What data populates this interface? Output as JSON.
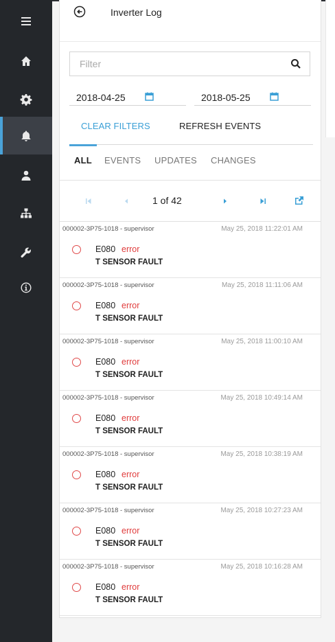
{
  "app": {
    "title": "Inverter Log"
  },
  "nav": {
    "items": [
      {
        "name": "menu",
        "icon": "hamburger-menu-icon"
      },
      {
        "name": "home",
        "icon": "home-icon"
      },
      {
        "name": "settings",
        "icon": "gear-icon"
      },
      {
        "name": "alerts",
        "icon": "bell-icon",
        "active": true
      },
      {
        "name": "user",
        "icon": "person-icon"
      },
      {
        "name": "hierarchy",
        "icon": "sitemap-icon"
      },
      {
        "name": "tools",
        "icon": "wrench-icon"
      },
      {
        "name": "info",
        "icon": "info-circle-icon"
      }
    ]
  },
  "filter": {
    "placeholder": "Filter",
    "value": ""
  },
  "dates": {
    "start": "2018-04-25",
    "end": "2018-05-25"
  },
  "actions": {
    "clear_filters": "CLEAR FILTERS",
    "refresh_events": "REFRESH EVENTS"
  },
  "tabs": [
    {
      "label": "ALL",
      "active": true
    },
    {
      "label": "EVENTS",
      "active": false
    },
    {
      "label": "UPDATES",
      "active": false
    },
    {
      "label": "CHANGES",
      "active": false
    }
  ],
  "pager": {
    "info": "1 of 42"
  },
  "events": [
    {
      "source": "000002-3P75-1018 - supervisor",
      "time": "May 25, 2018 11:22:01 AM",
      "code": "E080",
      "severity": "error",
      "description": "T SENSOR FAULT"
    },
    {
      "source": "000002-3P75-1018 - supervisor",
      "time": "May 25, 2018 11:11:06 AM",
      "code": "E080",
      "severity": "error",
      "description": "T SENSOR FAULT"
    },
    {
      "source": "000002-3P75-1018 - supervisor",
      "time": "May 25, 2018 11:00:10 AM",
      "code": "E080",
      "severity": "error",
      "description": "T SENSOR FAULT"
    },
    {
      "source": "000002-3P75-1018 - supervisor",
      "time": "May 25, 2018 10:49:14 AM",
      "code": "E080",
      "severity": "error",
      "description": "T SENSOR FAULT"
    },
    {
      "source": "000002-3P75-1018 - supervisor",
      "time": "May 25, 2018 10:38:19 AM",
      "code": "E080",
      "severity": "error",
      "description": "T SENSOR FAULT"
    },
    {
      "source": "000002-3P75-1018 - supervisor",
      "time": "May 25, 2018 10:27:23 AM",
      "code": "E080",
      "severity": "error",
      "description": "T SENSOR FAULT"
    },
    {
      "source": "000002-3P75-1018 - supervisor",
      "time": "May 25, 2018 10:16:28 AM",
      "code": "E080",
      "severity": "error",
      "description": "T SENSOR FAULT"
    }
  ],
  "colors": {
    "accent": "#4aa3d9",
    "nav_bg": "#24272b",
    "error": "#e03c3c"
  }
}
